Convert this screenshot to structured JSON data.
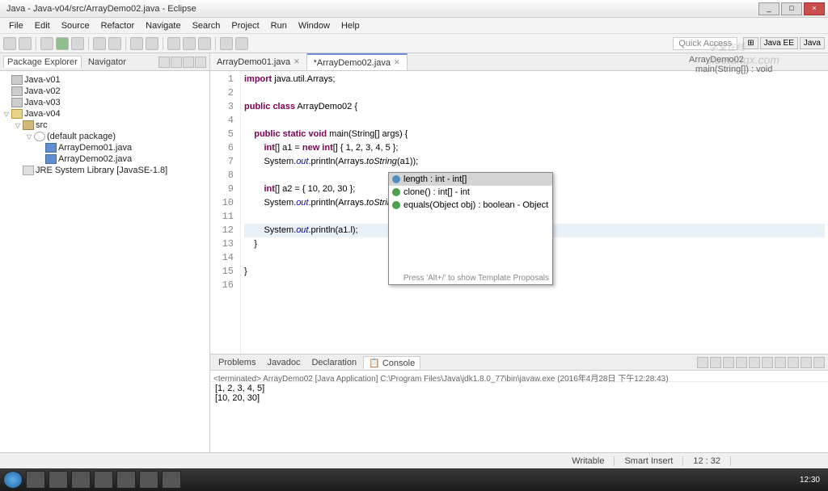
{
  "window": {
    "title": "Java - Java-v04/src/ArrayDemo02.java - Eclipse"
  },
  "menu": [
    "File",
    "Edit",
    "Source",
    "Refactor",
    "Navigate",
    "Search",
    "Project",
    "Run",
    "Window",
    "Help"
  ],
  "quick_access": "Quick Access",
  "perspectives": [
    "Java EE",
    "Java"
  ],
  "package_explorer": {
    "title": "Package Explorer",
    "navigator": "Navigator",
    "projects": [
      {
        "name": "Java-v01",
        "open": false
      },
      {
        "name": "Java-v02",
        "open": false
      },
      {
        "name": "Java-v03",
        "open": false
      },
      {
        "name": "Java-v04",
        "open": true,
        "children": [
          {
            "name": "src",
            "type": "src",
            "children": [
              {
                "name": "(default package)",
                "type": "pkg",
                "children": [
                  {
                    "name": "ArrayDemo01.java",
                    "type": "java"
                  },
                  {
                    "name": "ArrayDemo02.java",
                    "type": "java"
                  }
                ]
              }
            ]
          },
          {
            "name": "JRE System Library [JavaSE-1.8]",
            "type": "lib"
          }
        ]
      }
    ]
  },
  "editor": {
    "tabs": [
      {
        "label": "ArrayDemo01.java",
        "dirty": false,
        "active": false
      },
      {
        "label": "*ArrayDemo02.java",
        "dirty": true,
        "active": true
      }
    ],
    "lines": [
      {
        "n": 1,
        "seg": [
          [
            "kw",
            "import"
          ],
          [
            "",
            " java.util.Arrays;"
          ]
        ]
      },
      {
        "n": 2,
        "seg": [
          [
            "",
            ""
          ]
        ]
      },
      {
        "n": 3,
        "seg": [
          [
            "kw",
            "public class"
          ],
          [
            "",
            " ArrayDemo02 {"
          ]
        ]
      },
      {
        "n": 4,
        "seg": [
          [
            "",
            ""
          ]
        ]
      },
      {
        "n": 5,
        "seg": [
          [
            "",
            "    "
          ],
          [
            "kw",
            "public static void"
          ],
          [
            "",
            " main(String[] args) {"
          ]
        ],
        "mark": "-"
      },
      {
        "n": 6,
        "seg": [
          [
            "",
            "        "
          ],
          [
            "kw",
            "int"
          ],
          [
            "",
            "[] a1 = "
          ],
          [
            "kw",
            "new int"
          ],
          [
            "",
            "[] { 1, 2, 3, 4, 5 };"
          ]
        ]
      },
      {
        "n": 7,
        "seg": [
          [
            "",
            "        System."
          ],
          [
            "fld",
            "out"
          ],
          [
            "",
            ".println(Arrays."
          ],
          [
            "mth",
            "toString"
          ],
          [
            "",
            "(a1));"
          ]
        ]
      },
      {
        "n": 8,
        "seg": [
          [
            "",
            ""
          ]
        ]
      },
      {
        "n": 9,
        "seg": [
          [
            "",
            "        "
          ],
          [
            "kw",
            "int"
          ],
          [
            "",
            "[] a2 = { 10, 20, 30 };"
          ]
        ]
      },
      {
        "n": 10,
        "seg": [
          [
            "",
            "        System."
          ],
          [
            "fld",
            "out"
          ],
          [
            "",
            ".println(Arrays."
          ],
          [
            "mth",
            "toString"
          ],
          [
            "",
            "(a2));"
          ]
        ]
      },
      {
        "n": 11,
        "seg": [
          [
            "",
            ""
          ]
        ]
      },
      {
        "n": 12,
        "seg": [
          [
            "",
            "        System."
          ],
          [
            "fld",
            "out"
          ],
          [
            "",
            ".println(a1.l);"
          ]
        ],
        "hl": true
      },
      {
        "n": 13,
        "seg": [
          [
            "",
            "    }"
          ]
        ]
      },
      {
        "n": 14,
        "seg": [
          [
            "",
            ""
          ]
        ]
      },
      {
        "n": 15,
        "seg": [
          [
            "",
            "}"
          ]
        ]
      },
      {
        "n": 16,
        "seg": [
          [
            "",
            ""
          ]
        ]
      }
    ]
  },
  "autocomplete": {
    "items": [
      {
        "kind": "f",
        "label": "length : int - int[]",
        "sel": true
      },
      {
        "kind": "m",
        "label": "clone() : int[] - int"
      },
      {
        "kind": "m",
        "label": "equals(Object obj) : boolean - Object"
      }
    ],
    "hint": "Press 'Alt+/' to show Template Proposals"
  },
  "outline": {
    "items": [
      "ArrayDemo02",
      "main(String[]) : void"
    ]
  },
  "bottom": {
    "tabs": [
      "Problems",
      "Javadoc",
      "Declaration",
      "Console"
    ],
    "active": "Console",
    "terminated": "<terminated> ArrayDemo02 [Java Application] C:\\Program Files\\Java\\jdk1.8.0_77\\bin\\javaw.exe (2016年4月28日 下午12:28:43)",
    "output": [
      "[1, 2, 3, 4, 5]",
      "[10, 20, 30]"
    ]
  },
  "status": {
    "writable": "Writable",
    "insert": "Smart Insert",
    "pos": "12 : 32"
  },
  "taskbar": {
    "time": "12:30"
  },
  "watermark": {
    "main": "学堂在线",
    "sub": "xuetangx.com"
  }
}
